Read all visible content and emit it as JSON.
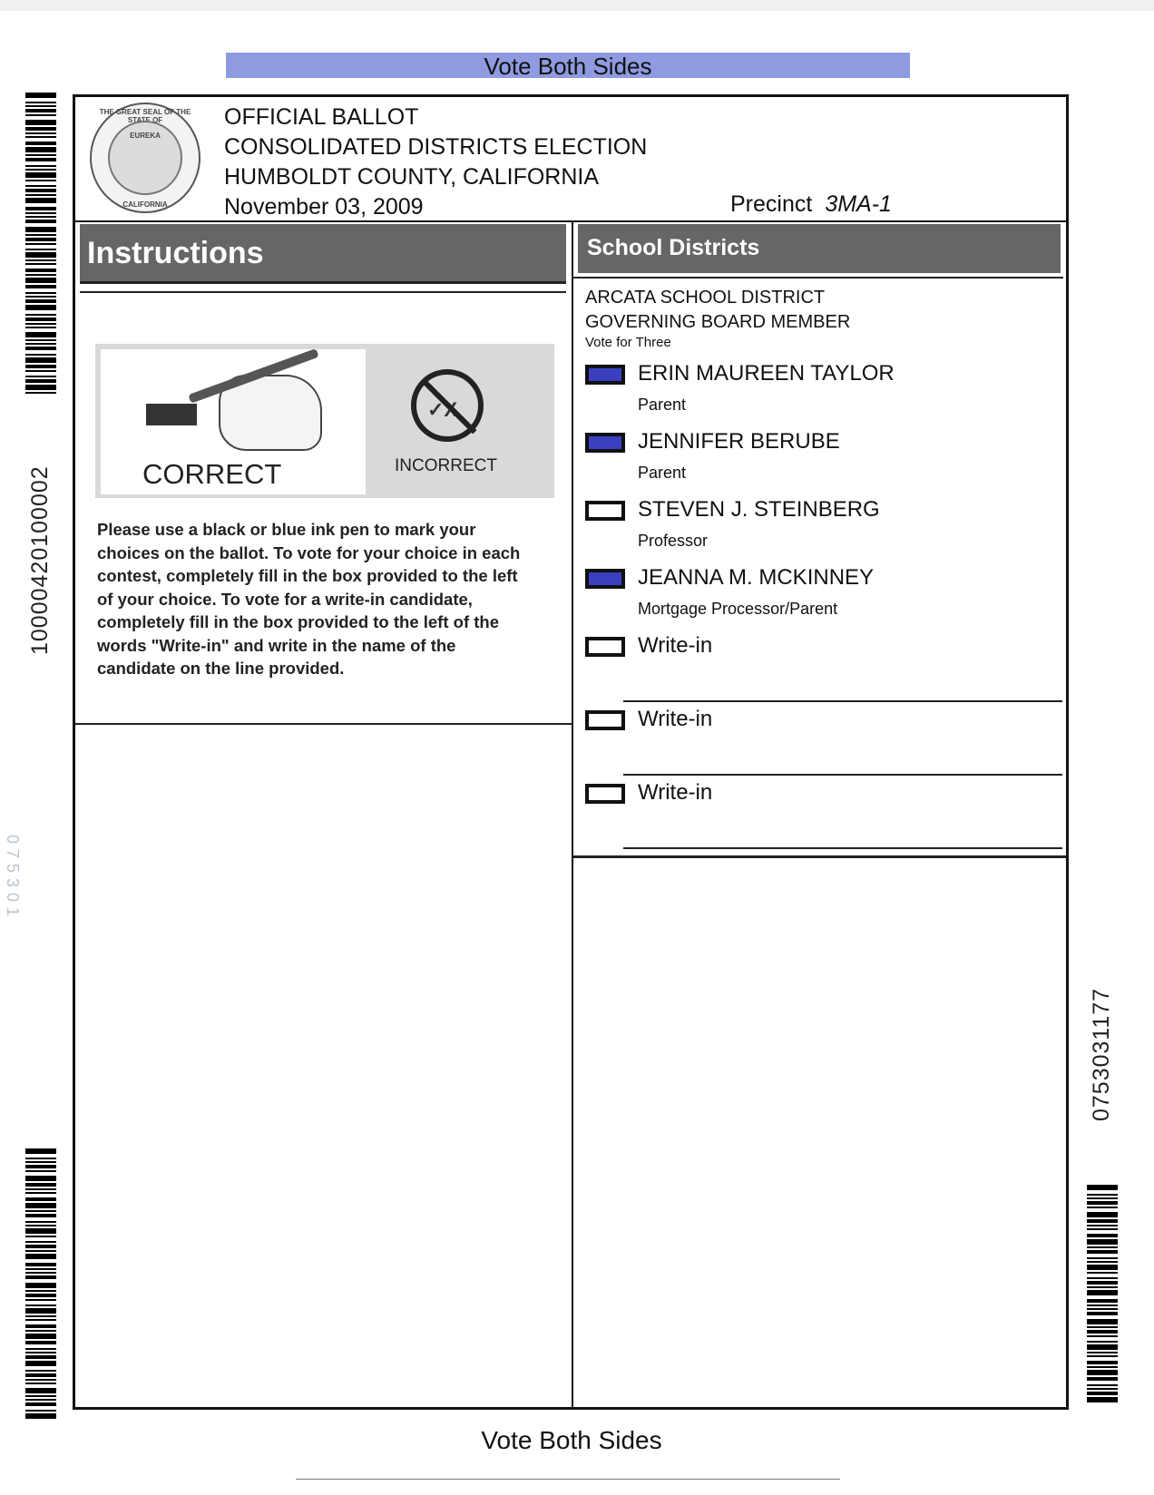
{
  "banner_top": "Vote Both Sides",
  "banner_bottom": "Vote Both Sides",
  "left_serial": "10000420100002",
  "faint_stamp": "075301",
  "right_serial": "0753031177",
  "seal": {
    "top_text": "THE GREAT SEAL OF THE STATE OF",
    "bottom_text": "CALIFORNIA",
    "motto": "EUREKA"
  },
  "header": {
    "line1": "OFFICIAL BALLOT",
    "line2": "CONSOLIDATED DISTRICTS ELECTION",
    "line3": "HUMBOLDT COUNTY, CALIFORNIA",
    "date": "November 03, 2009",
    "precinct_label": "Precinct",
    "precinct_value": "3MA-1"
  },
  "instructions": {
    "title": "Instructions",
    "correct_label": "CORRECT",
    "incorrect_label": "INCORRECT",
    "incorrect_marks": "✓X",
    "text": "Please use a black or blue ink pen to mark your choices on the ballot. To vote for your choice in each contest, completely fill in the box provided to the left of your choice. To vote for a write-in candidate, completely fill in the box provided to the left of the words \"Write-in\" and write in the name of the candidate on the line provided."
  },
  "section": {
    "title": "School Districts",
    "contest_line1": "ARCATA SCHOOL DISTRICT",
    "contest_line2": "GOVERNING BOARD MEMBER",
    "vote_for": "Vote for Three",
    "candidates": [
      {
        "name": "ERIN MAUREEN TAYLOR",
        "occupation": "Parent",
        "marked": true
      },
      {
        "name": "JENNIFER BERUBE",
        "occupation": "Parent",
        "marked": true
      },
      {
        "name": "STEVEN J. STEINBERG",
        "occupation": "Professor",
        "marked": false
      },
      {
        "name": "JEANNA M. MCKINNEY",
        "occupation": "Mortgage Processor/Parent",
        "marked": true
      }
    ],
    "write_ins": [
      "Write-in",
      "Write-in",
      "Write-in"
    ]
  },
  "colors": {
    "mark_fill": "#3a3fbf",
    "banner": "#8e9be0",
    "header_bar": "#666666"
  }
}
